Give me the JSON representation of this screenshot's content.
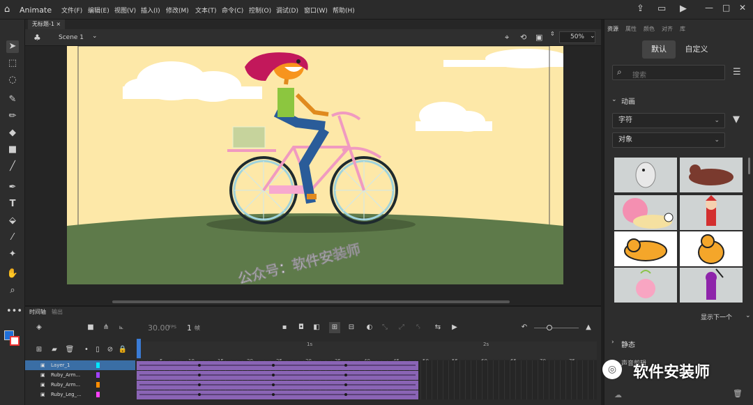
{
  "app": {
    "name": "Animate"
  },
  "menu": [
    "文件(F)",
    "编辑(E)",
    "视图(V)",
    "插入(I)",
    "修改(M)",
    "文本(T)",
    "命令(C)",
    "控制(O)",
    "调试(D)",
    "窗口(W)",
    "帮助(H)"
  ],
  "document": {
    "tab_title": "无标题-1",
    "scene": "Scene 1",
    "zoom": "50%"
  },
  "canvas_text": "公众号：软件安装师",
  "timeline": {
    "tabs": [
      "时间轴",
      "输出"
    ],
    "fps": "30.00",
    "fps_unit": "FPS",
    "frame": "1",
    "frame_unit": "帧",
    "ruler_ticks": [
      "5",
      "10",
      "15",
      "20",
      "25",
      "30",
      "35",
      "40",
      "45",
      "50",
      "55",
      "60",
      "65",
      "70",
      "75"
    ],
    "seconds": [
      "1s",
      "2s"
    ],
    "layers": [
      {
        "name": "Layer_1",
        "color": "#00e5ff"
      },
      {
        "name": "Ruby_Arm...",
        "color": "#a040ff"
      },
      {
        "name": "Ruby_Arm...",
        "color": "#ff8c00"
      },
      {
        "name": "Ruby_Leg_...",
        "color": "#ff40ff"
      }
    ]
  },
  "right_panel": {
    "tabs": [
      "资源",
      "属性",
      "颜色",
      "对齐",
      "库"
    ],
    "toggle": [
      "默认",
      "自定义"
    ],
    "search_placeholder": "搜索",
    "section_anim": "动画",
    "dropdown1": "字符",
    "dropdown2": "对象",
    "show_next": "显示下一个",
    "section_static": "静态",
    "sound_label": "声音剪辑"
  },
  "watermark": "软件安装师",
  "colors": {
    "purple_frames": "#8a64b5",
    "selected_layer": "#3a6ea5",
    "stage_bg": "#fde8a8",
    "ground": "#5e7a4a"
  }
}
